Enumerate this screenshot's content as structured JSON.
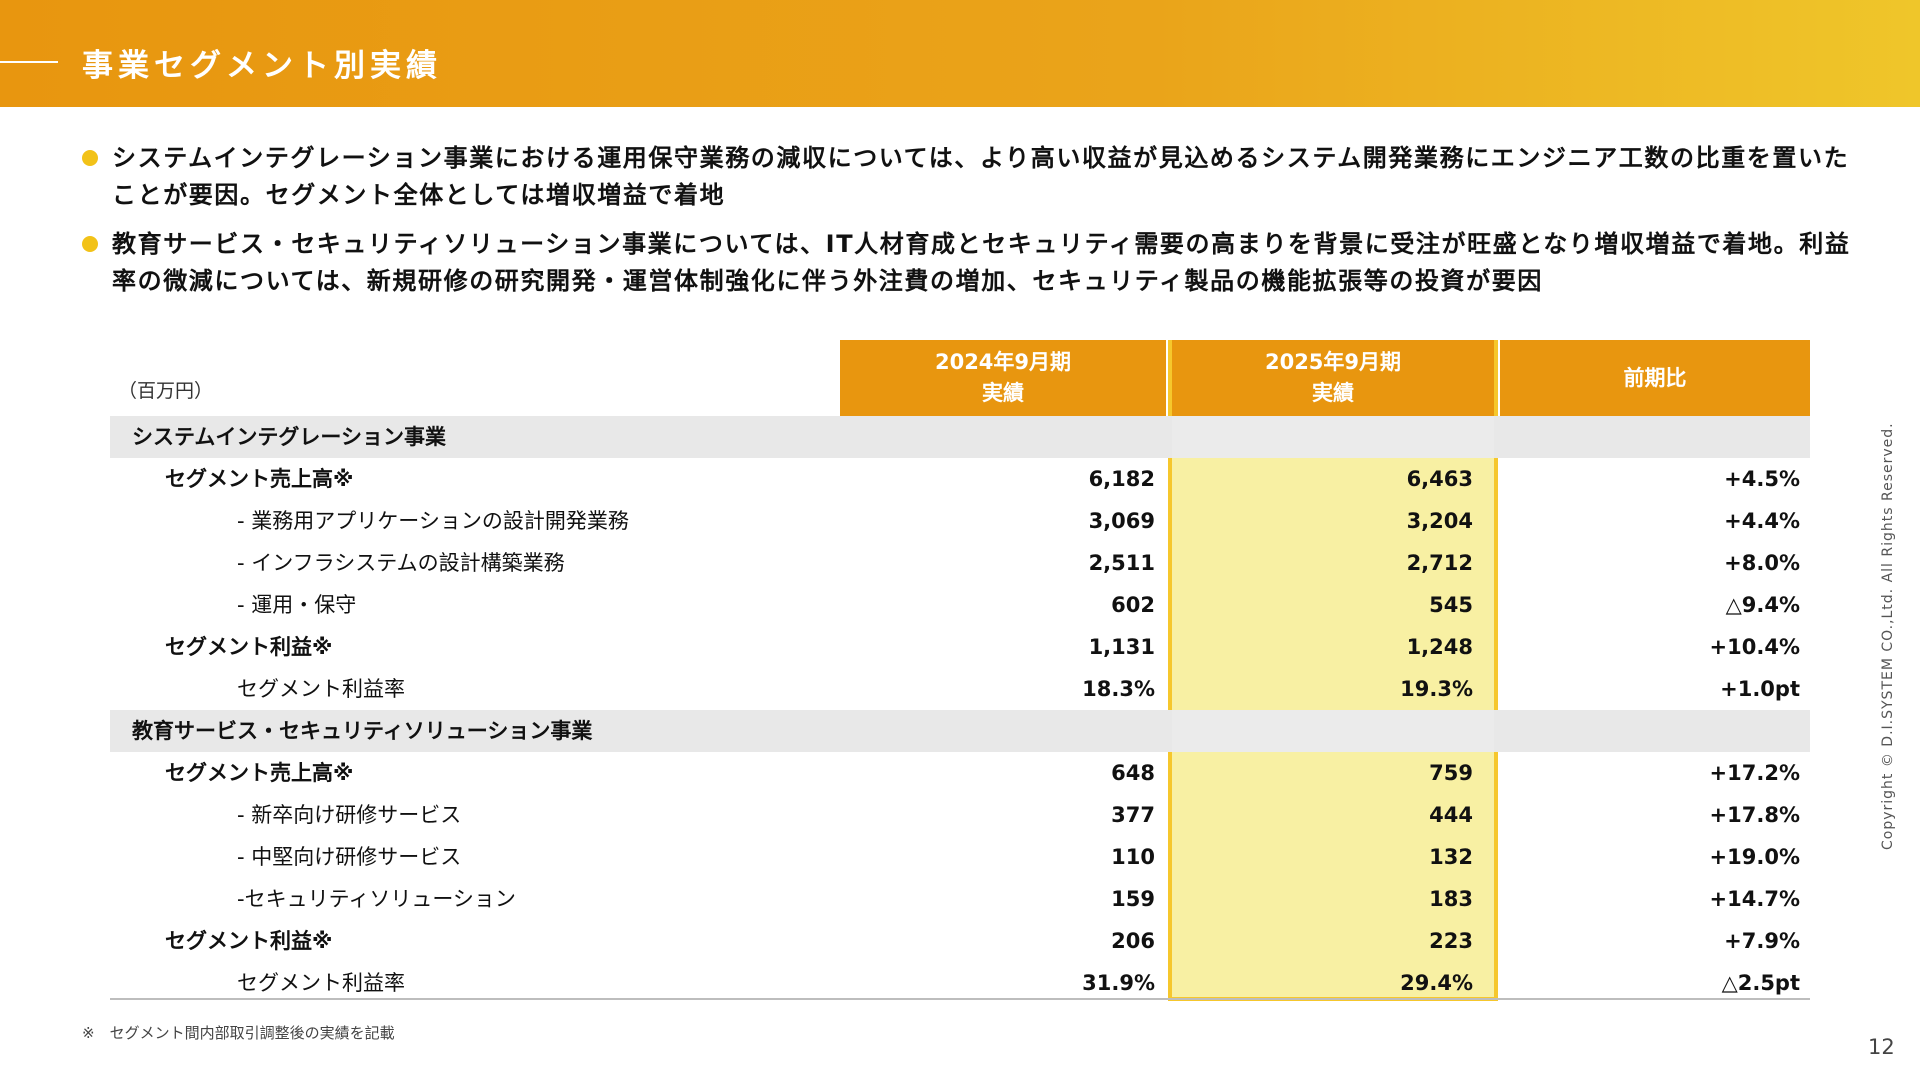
{
  "header": {
    "title": "事業セグメント別実績"
  },
  "bullets": [
    "システムインテグレーション事業における運用保守業務の減収については、より高い収益が見込めるシステム開発業務にエンジニア工数の比重を置いたことが要因。セグメント全体としては増収増益で着地",
    "教育サービス・セキュリティソリューション事業については、IT人材育成とセキュリティ需要の高まりを背景に受注が旺盛となり増収増益で着地。利益率の微減については、新規研修の研究開発・運営体制強化に伴う外注費の増加、セキュリティ製品の機能拡張等の投資が要因"
  ],
  "table": {
    "unit": "（百万円）",
    "headers": {
      "col1": [
        "2024年9月期",
        "実績"
      ],
      "col2": [
        "2025年9月期",
        "実績"
      ],
      "col3": "前期比"
    },
    "rows": [
      {
        "type": "section",
        "label": "システムインテグレーション事業"
      },
      {
        "type": "main",
        "label": "セグメント売上高※",
        "v1": "6,182",
        "v2": "6,463",
        "v3": "+4.5%"
      },
      {
        "type": "sub",
        "label": "- 業務用アプリケーションの設計開発業務",
        "v1": "3,069",
        "v2": "3,204",
        "v3": "+4.4%"
      },
      {
        "type": "sub",
        "label": "- インフラシステムの設計構築業務",
        "v1": "2,511",
        "v2": "2,712",
        "v3": "+8.0%"
      },
      {
        "type": "sub",
        "label": "- 運用・保守",
        "v1": "602",
        "v2": "545",
        "v3": "△9.4%"
      },
      {
        "type": "main",
        "label": "セグメント利益※",
        "v1": "1,131",
        "v2": "1,248",
        "v3": "+10.4%"
      },
      {
        "type": "sub",
        "label": "セグメント利益率",
        "v1": "18.3%",
        "v2": "19.3%",
        "v3": "+1.0pt"
      },
      {
        "type": "section",
        "label": "教育サービス・セキュリティソリューション事業"
      },
      {
        "type": "main",
        "label": "セグメント売上高※",
        "v1": "648",
        "v2": "759",
        "v3": "+17.2%"
      },
      {
        "type": "sub",
        "label": "- 新卒向け研修サービス",
        "v1": "377",
        "v2": "444",
        "v3": "+17.8%"
      },
      {
        "type": "sub",
        "label": "- 中堅向け研修サービス",
        "v1": "110",
        "v2": "132",
        "v3": "+19.0%"
      },
      {
        "type": "sub",
        "label": "-セキュリティソリューション",
        "v1": "159",
        "v2": "183",
        "v3": "+14.7%"
      },
      {
        "type": "main",
        "label": "セグメント利益※",
        "v1": "206",
        "v2": "223",
        "v3": "+7.9%"
      },
      {
        "type": "sub",
        "label": "セグメント利益率",
        "v1": "31.9%",
        "v2": "29.4%",
        "v3": "△2.5pt"
      }
    ]
  },
  "footnote": "※　セグメント間内部取引調整後の実績を記載",
  "copyright": "Copyright © D.I.SYSTEM CO.,Ltd. All Rights Reserved.",
  "page_number": "12",
  "colors": {
    "header_orange": "#e8960f",
    "highlight_fill": "#f8f0a3",
    "highlight_border": "#f6c72c",
    "bullet": "#f2c218"
  }
}
